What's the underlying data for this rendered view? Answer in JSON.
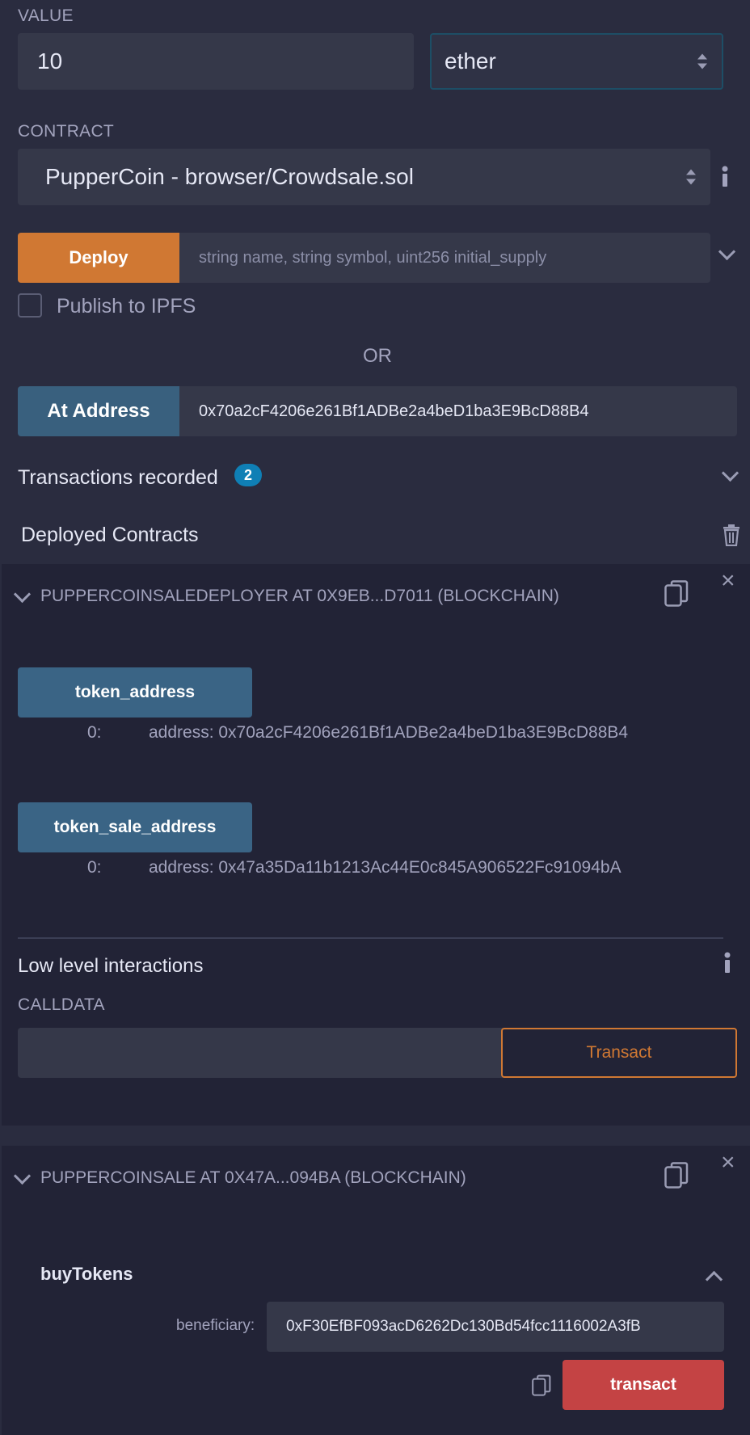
{
  "value_section": {
    "label": "VALUE",
    "amount": "10",
    "unit": "ether"
  },
  "contract_section": {
    "label": "CONTRACT",
    "selected": "PupperCoin - browser/Crowdsale.sol"
  },
  "deploy": {
    "button_label": "Deploy",
    "placeholder": "string name, string symbol, uint256 initial_supply",
    "publish_label": "Publish to IPFS",
    "or_label": "OR"
  },
  "at_address": {
    "button_label": "At Address",
    "value": "0x70a2cF4206e261Bf1ADBe2a4beD1ba3E9BcD88B4"
  },
  "transactions": {
    "label": "Transactions recorded",
    "count": "2"
  },
  "deployed": {
    "title": "Deployed Contracts"
  },
  "instance1": {
    "title": "PUPPERCOINSALEDEPLOYER AT 0X9EB...D7011 (BLOCKCHAIN)",
    "fn1_label": "token_address",
    "fn1_index": "0:",
    "fn1_result": "address: 0x70a2cF4206e261Bf1ADBe2a4beD1ba3E9BcD88B4",
    "fn2_label": "token_sale_address",
    "fn2_index": "0:",
    "fn2_result": "address: 0x47a35Da11b1213Ac44E0c845A906522Fc91094bA",
    "low_level_title": "Low level interactions",
    "calldata_label": "CALLDATA",
    "transact_label": "Transact"
  },
  "instance2": {
    "title": "PUPPERCOINSALE AT 0X47A...094BA (BLOCKCHAIN)",
    "fn_title": "buyTokens",
    "param_label": "beneficiary:",
    "param_value": "0xF30EfBF093acD6262Dc130Bd54fcc1116002A3fB",
    "transact_label": "transact"
  },
  "colors": {
    "deploy": "#d07833",
    "at_address": "#39607e",
    "function_button": "#3a6485",
    "transact_red": "#c44344",
    "badge": "#0f7fb5",
    "outline_orange": "#d07833"
  }
}
